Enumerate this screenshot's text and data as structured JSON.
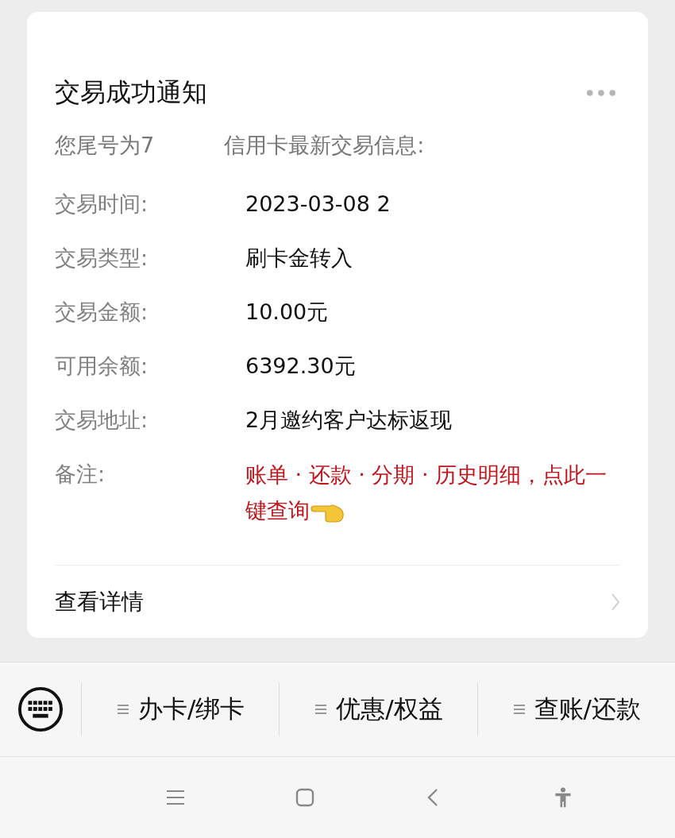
{
  "card": {
    "title": "交易成功通知",
    "intro": [
      "您尾号为7",
      "信用卡最新交易信息:"
    ],
    "fields": [
      {
        "label": "交易时间:",
        "value": "2023-03-08 2",
        "kind": "plain"
      },
      {
        "label": "交易类型:",
        "value": "刷卡金转入",
        "kind": "plain"
      },
      {
        "label": "交易金额:",
        "value": "10.00元",
        "kind": "plain"
      },
      {
        "label": "可用余额:",
        "value": "6392.30元",
        "kind": "plain"
      },
      {
        "label": "交易地址:",
        "value": "2月邀约客户达标返现",
        "kind": "plain"
      },
      {
        "label": "备注:",
        "value": "账单 · 还款 · 分期 · 历史明细，点此一键查询",
        "kind": "link"
      }
    ],
    "details_link": "查看详情"
  },
  "menu_bar": {
    "items": [
      "办卡/绑卡",
      "优惠/权益",
      "查账/还款"
    ]
  }
}
